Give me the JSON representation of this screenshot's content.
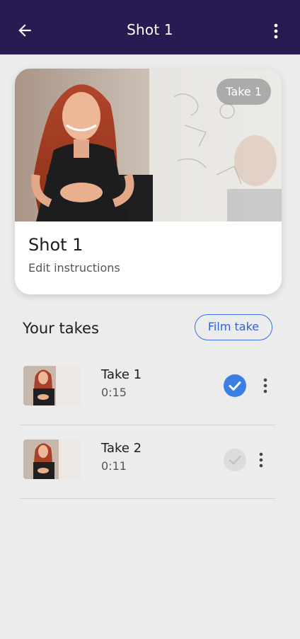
{
  "header": {
    "title": "Shot 1",
    "back_icon": "arrow-left-icon",
    "menu_icon": "more-vertical-icon",
    "background": "#2a1a52"
  },
  "shot": {
    "badge": "Take 1",
    "title": "Shot 1",
    "subtitle": "Edit instructions"
  },
  "takes_section": {
    "title": "Your takes",
    "film_button": "Film take",
    "accent": "#3a6fe0"
  },
  "takes": [
    {
      "name": "Take 1",
      "duration": "0:15",
      "selected": true
    },
    {
      "name": "Take 2",
      "duration": "0:11",
      "selected": false
    }
  ]
}
